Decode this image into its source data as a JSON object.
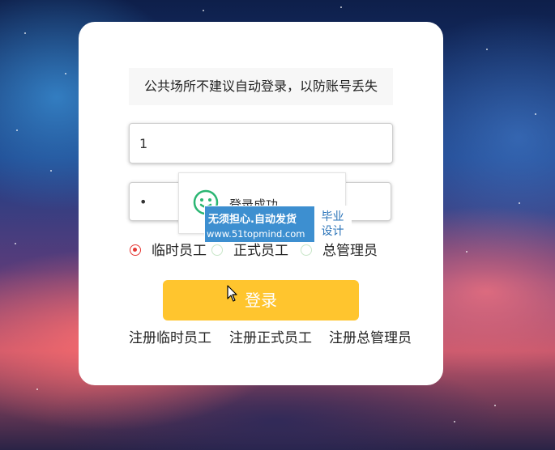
{
  "login": {
    "notice": "公共场所不建议自动登录，以防账号丢失",
    "username_value": "1",
    "password_value": "•",
    "roles": [
      {
        "label": "临时员工",
        "checked": true
      },
      {
        "label": "正式员工",
        "checked": false
      },
      {
        "label": "总管理员",
        "checked": false
      }
    ],
    "login_button": "登录",
    "register_links": [
      "注册临时员工",
      "注册正式员工",
      "注册总管理员"
    ]
  },
  "toast": {
    "icon": "smile-icon",
    "message": "登录成功"
  },
  "watermark": {
    "main_text": "无须担心.自动发货",
    "url": "www.51topmind.com",
    "side_text_1": "毕业",
    "side_text_2": "设计"
  },
  "colors": {
    "accent_button": "#ffc52e",
    "radio_checked": "#e53935",
    "radio_unchecked": "#c8e6c8",
    "toast_icon": "#2bb673",
    "watermark_bg": "#3d8fd0"
  }
}
